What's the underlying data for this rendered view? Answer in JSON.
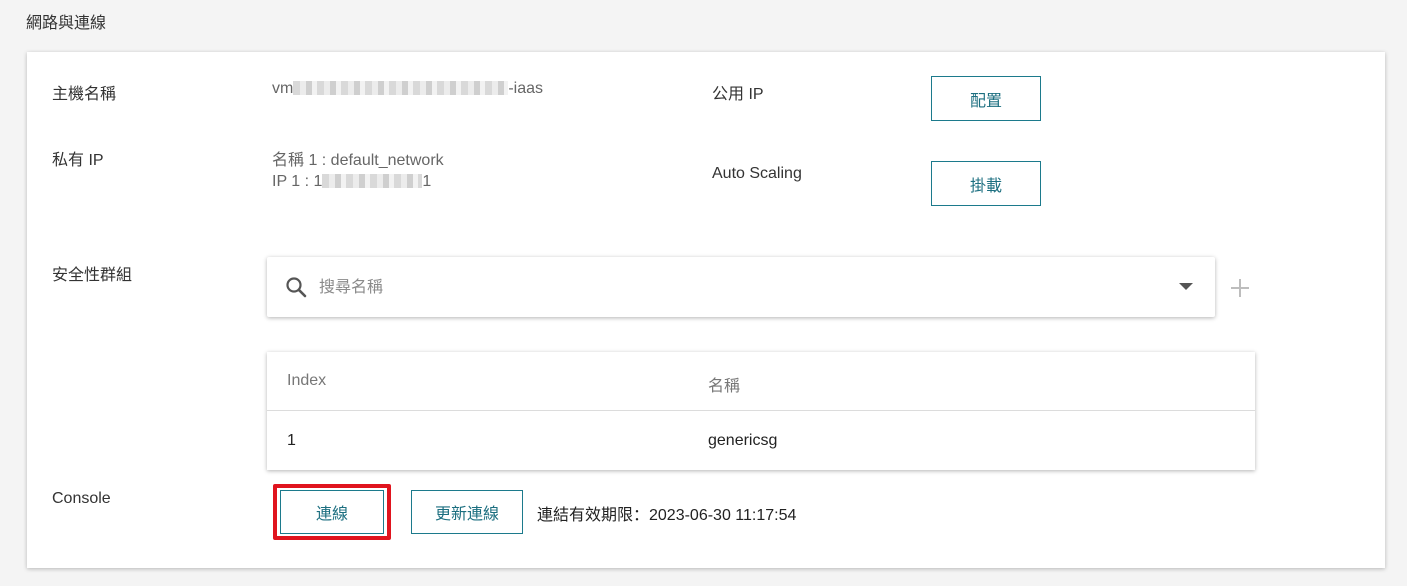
{
  "section": {
    "title": "網路與連線"
  },
  "host": {
    "label": "主機名稱",
    "value_prefix": "vm",
    "value_suffix": "-iaas"
  },
  "public_ip": {
    "label": "公用 IP",
    "button": "配置"
  },
  "private_ip": {
    "label": "私有 IP",
    "name_line": "名稱 1 : default_network",
    "ip_prefix": "IP 1 : 1",
    "ip_suffix": "1"
  },
  "auto_scaling": {
    "label": "Auto Scaling",
    "button": "掛載"
  },
  "security_group": {
    "label": "安全性群組",
    "search_placeholder": "搜尋名稱",
    "table": {
      "headers": [
        "Index",
        "名稱"
      ],
      "rows": [
        [
          "1",
          "genericsg"
        ]
      ]
    }
  },
  "console": {
    "label": "Console",
    "connect_button": "連線",
    "refresh_button": "更新連線",
    "expiry_text": "連結有效期限：2023-06-30 11:17:54"
  },
  "colors": {
    "accent": "#1c7a8c",
    "highlight": "#e0141e"
  }
}
